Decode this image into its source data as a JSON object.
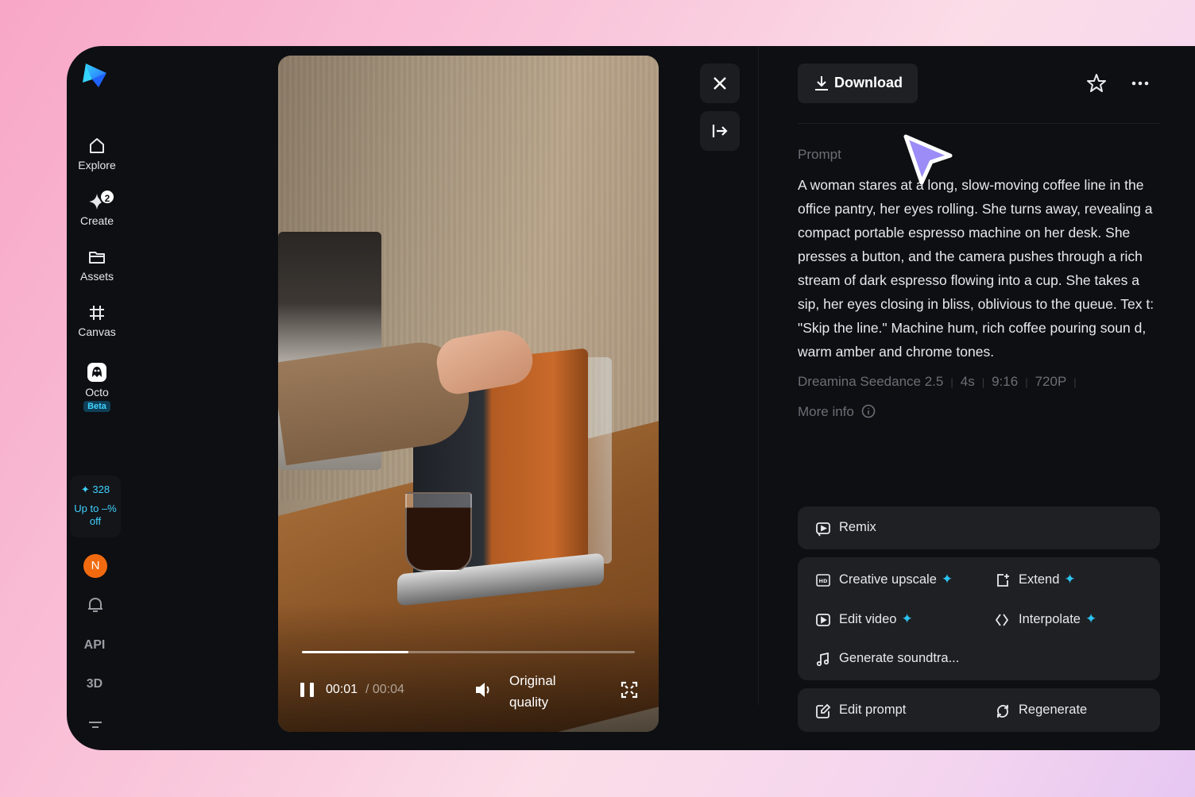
{
  "sidebar": {
    "items": [
      {
        "label": "Explore",
        "icon": "home-icon"
      },
      {
        "label": "Create",
        "icon": "sparkle-create-icon",
        "badge": "2"
      },
      {
        "label": "Assets",
        "icon": "folder-icon"
      },
      {
        "label": "Canvas",
        "icon": "canvas-frame-icon"
      },
      {
        "label": "Octo",
        "icon": "octo-icon",
        "tag": "Beta"
      }
    ],
    "credits": {
      "amount": "328",
      "promo_line1": "Up to –%",
      "promo_line2": "off"
    },
    "avatar_initial": "N",
    "api_label": "API",
    "threed_label": "3D"
  },
  "player": {
    "current_time": "00:01",
    "total_time": "/ 00:04",
    "progress": 0.32,
    "quality_line1": "Original",
    "quality_line2": "quality"
  },
  "header": {
    "download_label": "Download"
  },
  "prompt": {
    "label": "Prompt",
    "text": "A woman stares at a long, slow-moving coffee line in the office pantry, her eyes rolling. She turns away, revealing a compact portable espresso machine on her desk. She presses a button, and the camera pushes through a rich stream of dark espresso flowing into a cup. She takes a sip, her eyes closing in bliss, oblivious to the queue. Tex t: \"Skip the line.\" Machine hum, rich coffee pouring soun d, warm amber and chrome tones."
  },
  "meta": {
    "model": "Dreamina Seedance 2.5",
    "duration": "4s",
    "ratio": "9:16",
    "resolution": "720P",
    "more_info": "More info"
  },
  "actions": {
    "remix": "Remix",
    "creative_upscale": "Creative upscale",
    "extend": "Extend",
    "edit_video": "Edit video",
    "interpolate": "Interpolate",
    "generate_soundtrack": "Generate soundtra...",
    "edit_prompt": "Edit prompt",
    "regenerate": "Regenerate"
  },
  "colors": {
    "accent_cyan": "#2bc4f2",
    "cursor_purple": "#9b8cf7",
    "avatar_orange": "#f26a10"
  }
}
